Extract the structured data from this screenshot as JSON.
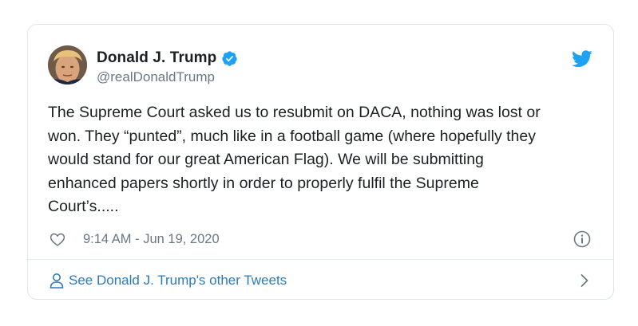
{
  "tweet": {
    "display_name": "Donald J. Trump",
    "handle": "@realDonaldTrump",
    "verified": true,
    "text": "The Supreme Court asked us to resubmit on DACA, nothing was lost or\nwon. They “punted”, much like in a football game (where hopefully they\nwould stand for our great American Flag). We will be submitting\nenhanced papers shortly in order to properly fulfil the Supreme\nCourt’s.....",
    "timestamp": "9:14 AM - Jun 19, 2020"
  },
  "footer": {
    "link_text": "See Donald J. Trump's other Tweets"
  },
  "icons": {
    "verified": "verified-badge-icon",
    "brand": "twitter-bird-icon",
    "like": "heart-icon",
    "info": "info-icon",
    "person": "person-icon",
    "chevron": "chevron-right-icon"
  },
  "colors": {
    "twitter_blue": "#1da1f2",
    "link_blue": "#2b7bb9",
    "muted_gray": "#697882",
    "text": "#1c2022",
    "border": "#dfe4e8"
  }
}
